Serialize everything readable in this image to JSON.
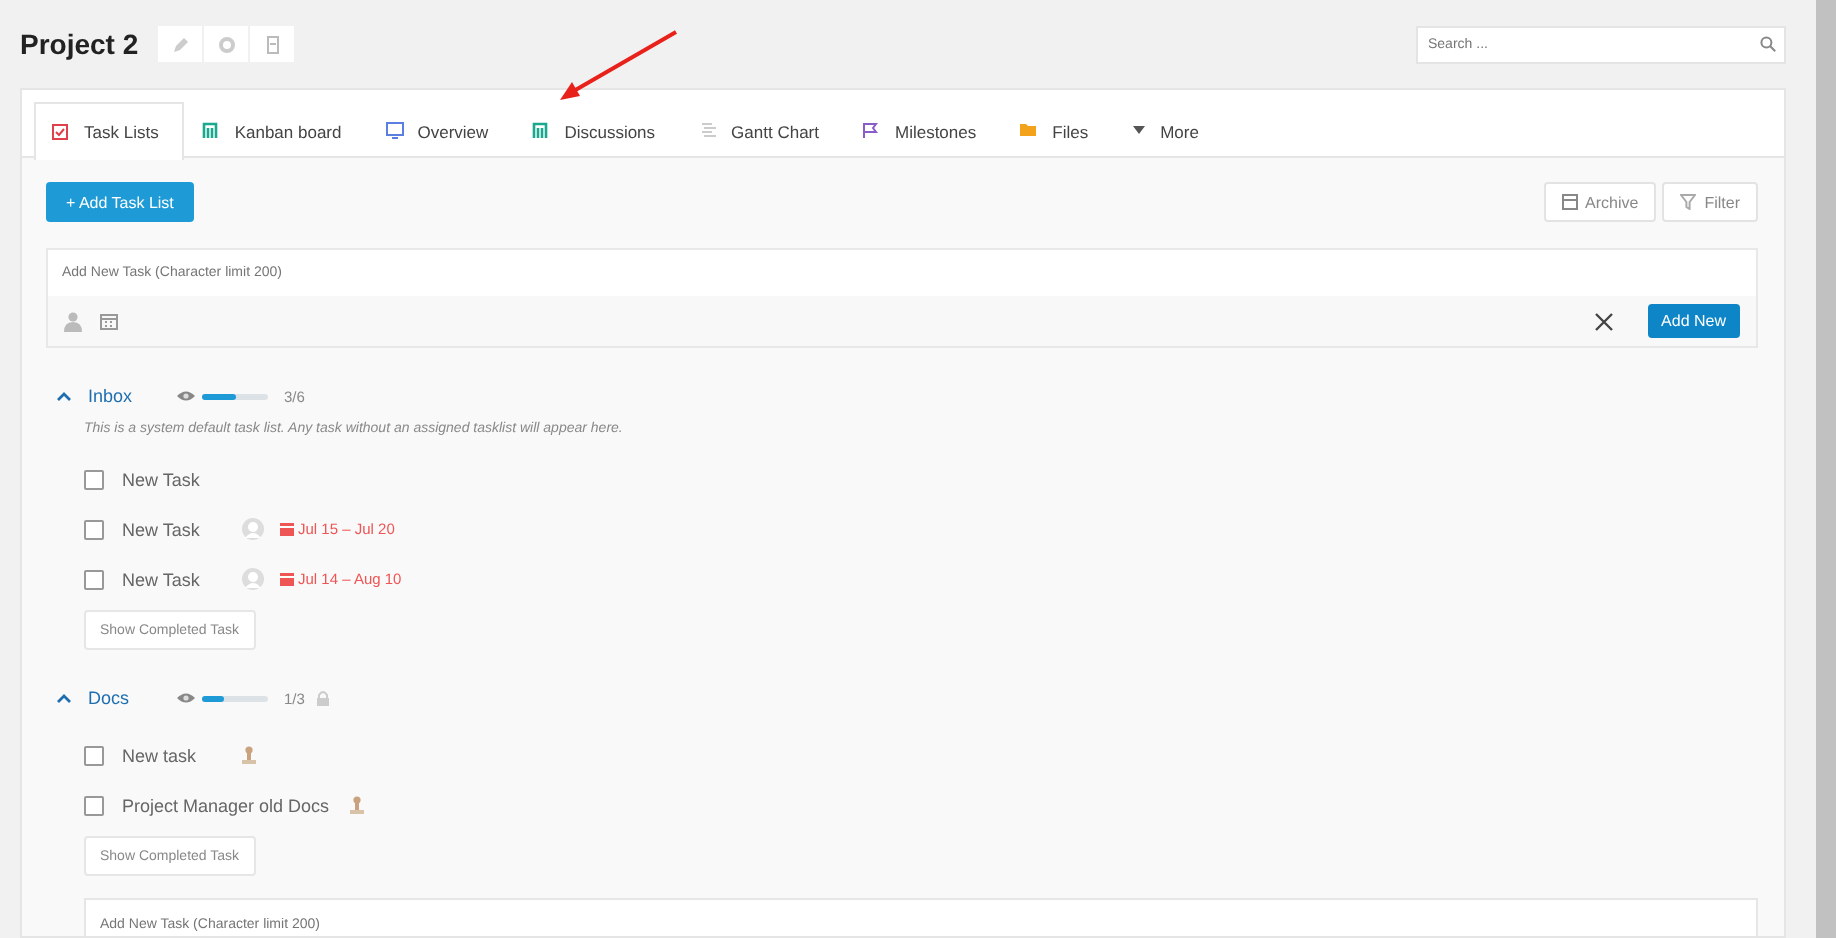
{
  "project": {
    "title": "Project 2"
  },
  "search": {
    "placeholder": "Search ..."
  },
  "tabs": [
    {
      "label": "Task Lists",
      "kind": "tasks",
      "selected": true
    },
    {
      "label": "Kanban board",
      "kind": "kanban",
      "selected": false
    },
    {
      "label": "Overview",
      "kind": "overview",
      "selected": false
    },
    {
      "label": "Discussions",
      "kind": "discussions",
      "selected": false
    },
    {
      "label": "Gantt Chart",
      "kind": "gantt",
      "selected": false
    },
    {
      "label": "Milestones",
      "kind": "milestones",
      "selected": false
    },
    {
      "label": "Files",
      "kind": "files",
      "selected": false
    },
    {
      "label": "More",
      "kind": "more",
      "selected": false
    }
  ],
  "toolbar": {
    "add_list": "+ Add Task List",
    "archive": "Archive",
    "filter": "Filter"
  },
  "new_task_form": {
    "placeholder": "Add New Task (Character limit 200)",
    "submit": "Add New"
  },
  "task_lists": [
    {
      "title": "Inbox",
      "expanded": true,
      "level": 0.5,
      "count": "3/6",
      "locked": false,
      "description": "This is a system default task list. Any task without an assigned tasklist will appear here.",
      "show_completed": "Show Completed Task",
      "tasks": [
        {
          "title": "New Task",
          "checked": false
        },
        {
          "title": "New Task",
          "checked": false,
          "assignee": {
            "kind": "blank"
          },
          "due": "Jul 15 – Jul 20"
        },
        {
          "title": "New Task",
          "checked": false,
          "assignee": {
            "kind": "blank"
          },
          "due": "Jul 14 – Aug 10"
        }
      ]
    },
    {
      "title": "Docs",
      "expanded": true,
      "level": 0.33,
      "count": "1/3",
      "locked": true,
      "show_completed": "Show Completed Task",
      "new_task_placeholder": "Add New Task (Character limit 200)",
      "tasks": [
        {
          "title": "New task",
          "checked": false,
          "assignee": {
            "kind": "figure"
          }
        },
        {
          "title": "Project Manager old Docs",
          "checked": false,
          "assignee": {
            "kind": "figure"
          }
        }
      ]
    }
  ]
}
